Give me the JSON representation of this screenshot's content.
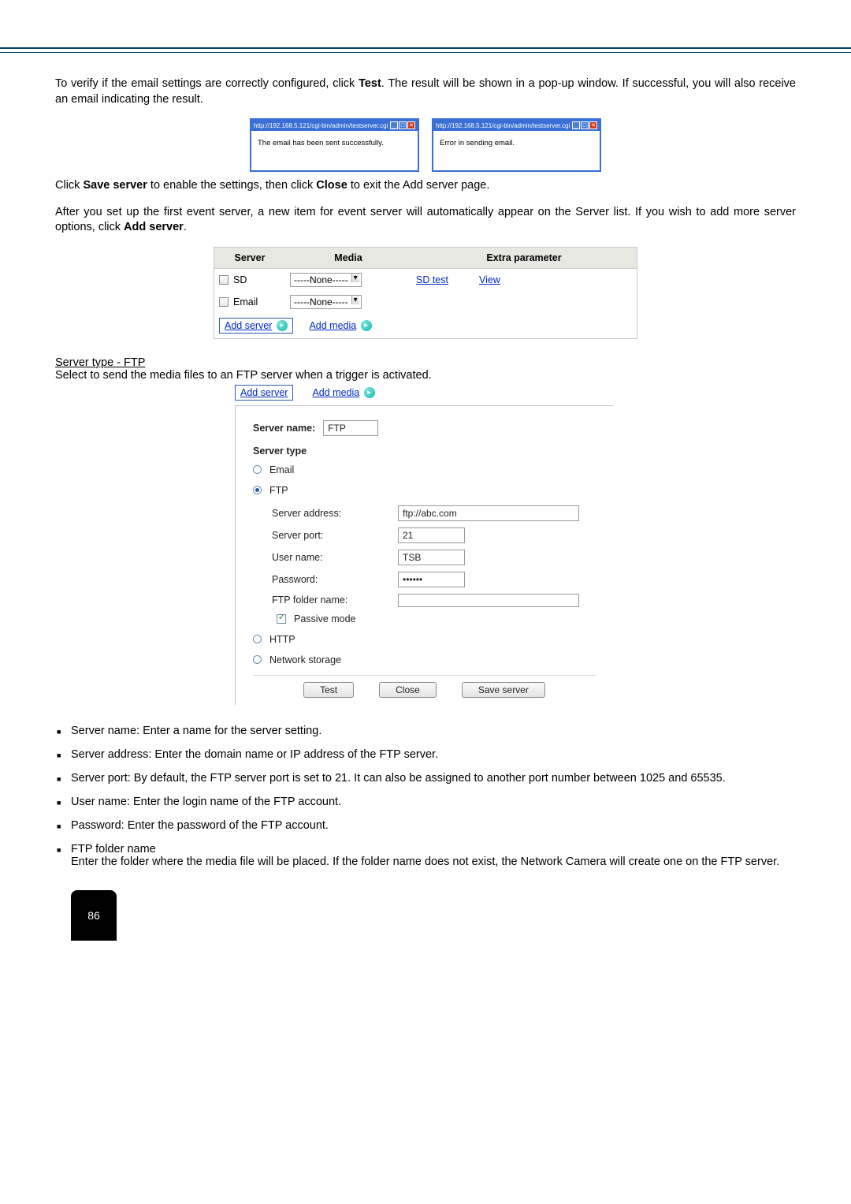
{
  "paragraphs": {
    "verify": "To verify if the email settings are correctly configured, click Test. The result will be shown in a pop-up window. If successful, you will also receive an email indicating the result.",
    "click_save": "Click Save server to enable the settings, then click Close to exit the Add server page.",
    "after_setup": "After you set up the first event server, a new item for event server will automatically appear on the Server list. If you wish to add more server options, click Add server.",
    "section_title": "Server type - FTP",
    "ftp_select": "Select to send the media files to an FTP server when a trigger is activated."
  },
  "popups": {
    "url": "http://192.168.5.121/cgi-bin/admin/testserver.cgi",
    "success_msg": "The email has been sent successfully.",
    "error_msg": "Error in sending email."
  },
  "server_table": {
    "headers": {
      "server": "Server",
      "media": "Media",
      "extra": "Extra parameter"
    },
    "rows": [
      {
        "name": "SD",
        "media": "-----None-----",
        "link1": "SD test",
        "link2": "View"
      },
      {
        "name": "Email",
        "media": "-----None-----"
      }
    ],
    "add_server": "Add server",
    "add_media": "Add media"
  },
  "ftp_panel": {
    "tabs": {
      "add_server": "Add server",
      "add_media": "Add media"
    },
    "server_name_label": "Server name:",
    "server_name_value": "FTP",
    "server_type_label": "Server type",
    "options": {
      "email": "Email",
      "ftp": "FTP",
      "http": "HTTP",
      "ns": "Network storage"
    },
    "fields": {
      "server_address": {
        "label": "Server address:",
        "value": "ftp://abc.com"
      },
      "server_port": {
        "label": "Server port:",
        "value": "21"
      },
      "user_name": {
        "label": "User name:",
        "value": "TSB"
      },
      "password": {
        "label": "Password:",
        "value": "••••••"
      },
      "ftp_folder": {
        "label": "FTP folder name:",
        "value": ""
      },
      "passive": {
        "label": "Passive mode"
      }
    },
    "buttons": {
      "test": "Test",
      "close": "Close",
      "save": "Save server"
    }
  },
  "bullets": {
    "server_name": "Server name: Enter a name for the server setting.",
    "server_address": "Server address: Enter the domain name or IP address of the FTP server.",
    "server_port": "Server port: By default, the FTP server port is set to 21. It can also be assigned to another port number between 1025 and 65535.",
    "user_name": "User name: Enter the login name of the FTP account.",
    "password": "Password: Enter the password of the FTP account.",
    "ftp_folder_title": "FTP folder name",
    "ftp_folder_body": "Enter the folder where the media file will be placed. If the folder name does not exist, the Network Camera will create one on the FTP server."
  },
  "page_number": "86"
}
